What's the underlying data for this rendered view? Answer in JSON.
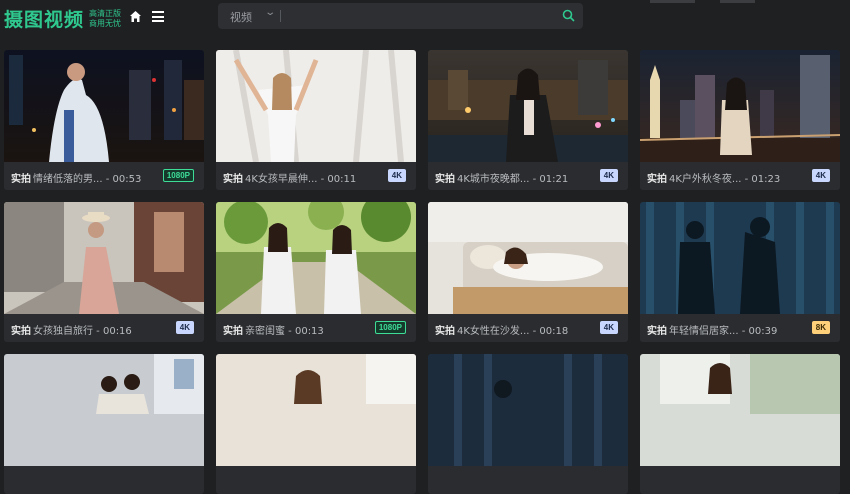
{
  "header": {
    "logo_main": "摄图视频",
    "logo_sub_line1": "高清正版",
    "logo_sub_line2": "商用无忧",
    "search": {
      "category": "视频",
      "placeholder": ""
    }
  },
  "cards": [
    {
      "tag": "实拍",
      "title": "情绪低落的男... - 00:53",
      "badge": "1080P"
    },
    {
      "tag": "实拍",
      "title": "4K女孩早晨伸... - 00:11",
      "badge": "4K"
    },
    {
      "tag": "实拍",
      "title": "4K城市夜晚都... - 01:21",
      "badge": "4K"
    },
    {
      "tag": "实拍",
      "title": "4K户外秋冬夜... - 01:23",
      "badge": "4K"
    },
    {
      "tag": "实拍",
      "title": "女孩独自旅行 - 00:16",
      "badge": "4K"
    },
    {
      "tag": "实拍",
      "title": "亲密闺蜜 - 00:13",
      "badge": "1080P"
    },
    {
      "tag": "实拍",
      "title": "4K女性在沙发... - 00:18",
      "badge": "4K"
    },
    {
      "tag": "实拍",
      "title": "年轻情侣居家... - 00:39",
      "badge": "8K"
    }
  ]
}
